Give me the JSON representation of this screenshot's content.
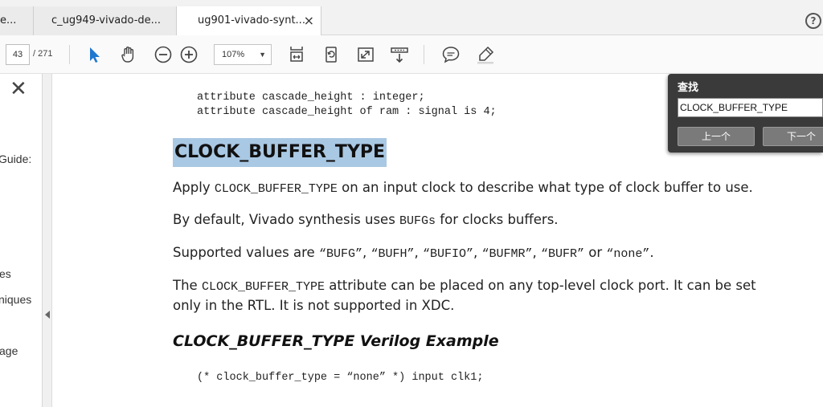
{
  "tabs": [
    {
      "label": "e..."
    },
    {
      "label": "c_ug949-vivado-de..."
    },
    {
      "label": "ug901-vivado-synt...",
      "close": "×",
      "active": true
    }
  ],
  "help_glyph": "?",
  "toolbar": {
    "page_current": "43",
    "page_total": "/ 271",
    "zoom": "107%",
    "zoom_caret": "▼",
    "icons": [
      "select-arrow-icon",
      "hand-tool-icon",
      "zoom-out-icon",
      "zoom-in-icon",
      "fit-width-icon",
      "rotate-icon",
      "fullscreen-icon",
      "download-icon",
      "comment-icon",
      "highlight-pen-icon"
    ],
    "accent": "#1f77d0"
  },
  "sidebar": {
    "close_glyph": "✕",
    "items": [
      "Guide:",
      "es",
      "niques",
      "age"
    ]
  },
  "document": {
    "code_top": [
      "attribute cascade_height : integer;",
      "attribute cascade_height of ram : signal is 4;"
    ],
    "heading": "CLOCK_BUFFER_TYPE",
    "heading_highlight": "#a9c8e3",
    "p1": {
      "a": "Apply ",
      "code": "CLOCK_BUFFER_TYPE",
      "b": " on an input clock to describe what type of clock buffer to use."
    },
    "p2": {
      "a": "By default, Vivado synthesis uses ",
      "code": "BUFGs",
      "b": " for clocks buffers."
    },
    "p3": {
      "a": "Supported values are ",
      "v1": "“BUFG”",
      "s1": ", ",
      "v2": "“BUFH”",
      "s2": ", ",
      "v3": "“BUFIO”",
      "s3": ", ",
      "v4": "“BUFMR”",
      "s4": ", ",
      "v5": "“BUFR”",
      "s5": " or ",
      "v6": "“none”",
      "b": "."
    },
    "p4": {
      "a": "The ",
      "code": "CLOCK_BUFFER_TYPE",
      "b": " attribute can be placed on any top-level clock port. It can be set",
      "line2": "only in the RTL. It is not supported in XDC."
    },
    "subheading": "CLOCK_BUFFER_TYPE Verilog Example",
    "code_bottom": "(* clock_buffer_type = “none” *) input clk1;"
  },
  "find": {
    "title": "查找",
    "query": "CLOCK_BUFFER_TYPE",
    "prev": "上一个",
    "next": "下一个"
  }
}
